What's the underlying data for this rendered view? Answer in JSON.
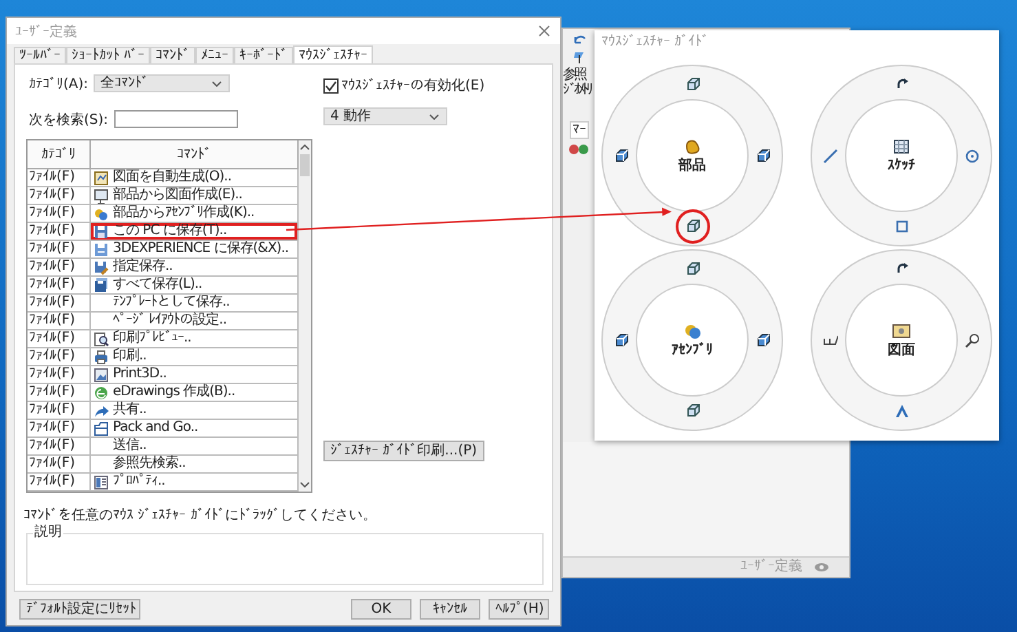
{
  "dialog": {
    "title": "ﾕｰｻﾞｰ定義",
    "tabs": [
      {
        "label": "ﾂｰﾙﾊﾞｰ",
        "selected": false
      },
      {
        "label": "ｼｮｰﾄｶｯﾄ ﾊﾞｰ",
        "selected": false
      },
      {
        "label": "ｺﾏﾝﾄﾞ",
        "selected": false
      },
      {
        "label": "ﾒﾆｭｰ",
        "selected": false
      },
      {
        "label": "ｷｰﾎﾞｰﾄﾞ",
        "selected": false
      },
      {
        "label": "ﾏｳｽｼﾞｪｽﾁｬｰ",
        "selected": true
      }
    ],
    "category": {
      "label": "ｶﾃｺﾞﾘ(A):",
      "value": "全ｺﾏﾝﾄﾞ"
    },
    "search": {
      "label": "次を検索(S):"
    },
    "enable_gestures": {
      "label": "ﾏｳｽｼﾞｪｽﾁｬｰの有効化(E)",
      "checked": true
    },
    "gesture_count": {
      "value": "4 動作"
    },
    "table": {
      "columns": [
        "ｶﾃｺﾞﾘ",
        "ｺﾏﾝﾄﾞ"
      ],
      "rows": [
        {
          "category": "ﾌｧｲﾙ(F)",
          "command": "図面を自動生成(O)..",
          "marked": false
        },
        {
          "category": "ﾌｧｲﾙ(F)",
          "command": "部品から図面作成(E)..",
          "marked": false
        },
        {
          "category": "ﾌｧｲﾙ(F)",
          "command": "部品からｱｾﾝﾌﾞﾘ作成(K)..",
          "marked": false
        },
        {
          "category": "ﾌｧｲﾙ(F)",
          "command": "この PC に保存(T)..",
          "marked": true
        },
        {
          "category": "ﾌｧｲﾙ(F)",
          "command": "3DEXPERIENCE に保存(&X)..",
          "marked": false
        },
        {
          "category": "ﾌｧｲﾙ(F)",
          "command": "指定保存..",
          "marked": false
        },
        {
          "category": "ﾌｧｲﾙ(F)",
          "command": "すべて保存(L)..",
          "marked": false
        },
        {
          "category": "ﾌｧｲﾙ(F)",
          "command": "ﾃﾝﾌﾟﾚｰﾄとして保存..",
          "marked": false
        },
        {
          "category": "ﾌｧｲﾙ(F)",
          "command": "ﾍﾟｰｼﾞ ﾚｲｱｳﾄの設定..",
          "marked": false
        },
        {
          "category": "ﾌｧｲﾙ(F)",
          "command": "印刷ﾌﾟﾚﾋﾞｭｰ..",
          "marked": false
        },
        {
          "category": "ﾌｧｲﾙ(F)",
          "command": "印刷..",
          "marked": false
        },
        {
          "category": "ﾌｧｲﾙ(F)",
          "command": "Print3D..",
          "marked": false
        },
        {
          "category": "ﾌｧｲﾙ(F)",
          "command": "eDrawings 作成(B)..",
          "marked": false
        },
        {
          "category": "ﾌｧｲﾙ(F)",
          "command": "共有..",
          "marked": false
        },
        {
          "category": "ﾌｧｲﾙ(F)",
          "command": "Pack and Go..",
          "marked": false
        },
        {
          "category": "ﾌｧｲﾙ(F)",
          "command": "送信..",
          "marked": false
        },
        {
          "category": "ﾌｧｲﾙ(F)",
          "command": "参照先検索..",
          "marked": false
        },
        {
          "category": "ﾌｧｲﾙ(F)",
          "command": "ﾌﾟﾛﾊﾟﾃｨ..",
          "marked": false
        }
      ]
    },
    "print_button": "ｼﾞｪｽﾁｬｰ ｶﾞｲﾄﾞ印刷...(P)",
    "hint": "ｺﾏﾝﾄﾞを任意のﾏｳｽ ｼﾞｪｽﾁｬｰ ｶﾞｲﾄﾞにﾄﾞﾗｯｸﾞしてください。",
    "description": {
      "label": "説明"
    },
    "reset_button": "ﾃﾞﾌｫﾙﾄ設定にﾘｾｯﾄ",
    "buttons": [
      "OK",
      "ｷｬﾝｾﾙ",
      "ﾍﾙﾌﾟ(H)"
    ]
  },
  "app_window": {
    "ribbon_button": [
      "参照",
      "ｼﾞｵﾒﾄﾘ"
    ],
    "tab": "ﾏｰ",
    "status": "ﾕｰｻﾞｰ定義"
  },
  "gesture_guide": {
    "title": "ﾏｳｽｼﾞｪｽﾁｬｰ ｶﾞｲﾄﾞ",
    "groups": [
      {
        "label": "部品",
        "slots": [
          {
            "circled": false
          },
          {
            "circled": false
          },
          {
            "circled": false
          },
          {
            "circled": true
          }
        ]
      },
      {
        "label": "ｽｹｯﾁ",
        "slots": [
          {
            "circled": false
          },
          {
            "circled": false
          },
          {
            "circled": false
          },
          {
            "circled": false
          }
        ]
      },
      {
        "label": "ｱｾﾝﾌﾞﾘ",
        "slots": [
          {
            "circled": false
          },
          {
            "circled": false
          },
          {
            "circled": false
          },
          {
            "circled": false
          }
        ]
      },
      {
        "label": "図面",
        "slots": [
          {
            "circled": false
          },
          {
            "circled": false
          },
          {
            "circled": false
          },
          {
            "circled": false
          }
        ]
      }
    ]
  }
}
